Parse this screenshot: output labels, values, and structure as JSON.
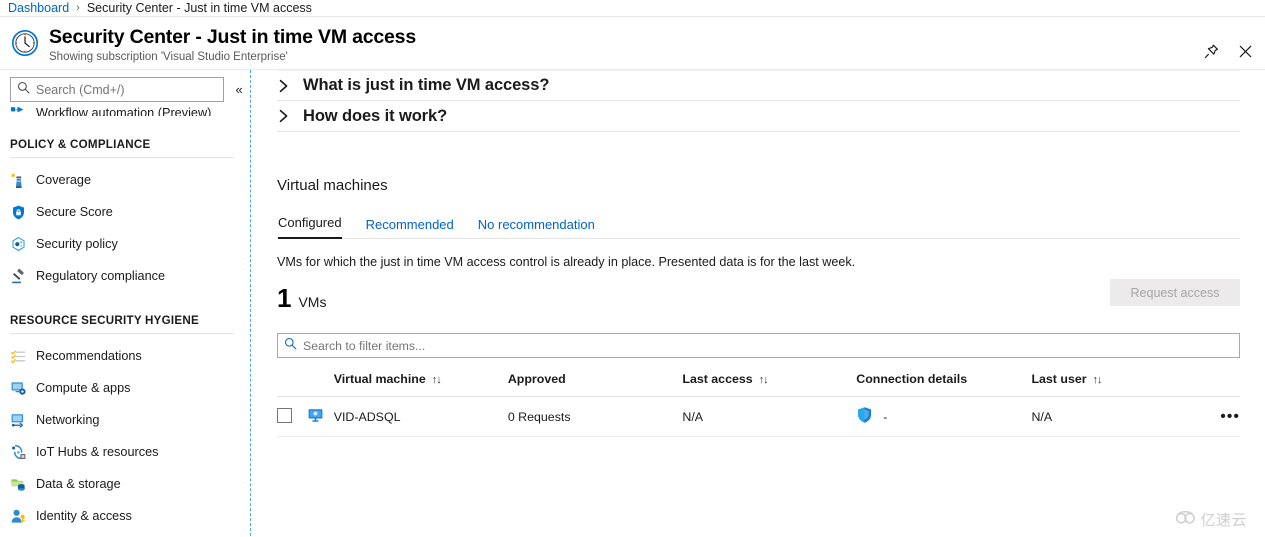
{
  "breadcrumb": {
    "root": "Dashboard",
    "separator": "›",
    "current": "Security Center - Just in time VM access"
  },
  "header": {
    "title": "Security Center - Just in time VM access",
    "subtitle": "Showing subscription 'Visual Studio Enterprise'",
    "icon": "clock-icon",
    "actions": [
      {
        "name": "pin-blade-button",
        "icon": "pin-icon",
        "label": "Pin"
      },
      {
        "name": "close-blade-button",
        "icon": "close-icon",
        "label": "Close"
      }
    ]
  },
  "sidebar": {
    "search": {
      "placeholder": "Search (Cmd+/)",
      "value": "",
      "icon": "search-icon"
    },
    "collapse_label": "«",
    "clipped_item": {
      "label": "Workflow automation (Preview)",
      "icon": "workflow-icon"
    },
    "groups": [
      {
        "title": "POLICY & COMPLIANCE",
        "items": [
          {
            "label": "Coverage",
            "icon": "lighthouse-icon"
          },
          {
            "label": "Secure Score",
            "icon": "shield-icon"
          },
          {
            "label": "Security policy",
            "icon": "policy-hexagon-icon"
          },
          {
            "label": "Regulatory compliance",
            "icon": "gavel-icon"
          }
        ]
      },
      {
        "title": "RESOURCE SECURITY HYGIENE",
        "items": [
          {
            "label": "Recommendations",
            "icon": "checklist-icon"
          },
          {
            "label": "Compute & apps",
            "icon": "compute-icon"
          },
          {
            "label": "Networking",
            "icon": "networking-icon"
          },
          {
            "label": "IoT Hubs & resources",
            "icon": "iot-hub-icon"
          },
          {
            "label": "Data & storage",
            "icon": "database-icon"
          },
          {
            "label": "Identity & access",
            "icon": "identity-icon"
          }
        ]
      }
    ]
  },
  "main": {
    "accordions": [
      {
        "label": "What is just in time VM access?",
        "icon": "chevron-right-icon",
        "expanded": false
      },
      {
        "label": "How does it work?",
        "icon": "chevron-right-icon",
        "expanded": false
      }
    ],
    "section_title": "Virtual machines",
    "tabs": [
      {
        "label": "Configured",
        "active": true
      },
      {
        "label": "Recommended",
        "active": false
      },
      {
        "label": "No recommendation",
        "active": false
      }
    ],
    "tab_description": "VMs for which the just in time VM access control is already in place. Presented data is for the last week.",
    "count": {
      "number": "1",
      "unit": "VMs"
    },
    "request_access": {
      "label": "Request access",
      "disabled": true
    },
    "filter": {
      "placeholder": "Search to filter items...",
      "value": "",
      "icon": "search-icon"
    },
    "table": {
      "columns": [
        {
          "label": "",
          "name": "select-all-column",
          "sortable": false
        },
        {
          "label": "",
          "name": "icon-column",
          "sortable": false
        },
        {
          "label": "Virtual machine",
          "name": "virtual-machine-column",
          "sortable": true
        },
        {
          "label": "Approved",
          "name": "approved-column",
          "sortable": false
        },
        {
          "label": "Last access",
          "name": "last-access-column",
          "sortable": true
        },
        {
          "label": "Connection details",
          "name": "connection-details-column",
          "sortable": false
        },
        {
          "label": "Last user",
          "name": "last-user-column",
          "sortable": true
        },
        {
          "label": "",
          "name": "actions-column",
          "sortable": false
        }
      ],
      "sort_glyph": "↑↓",
      "rows": [
        {
          "selected": false,
          "icon": "virtual-machine-icon",
          "virtual_machine": "VID-ADSQL",
          "approved": "0 Requests",
          "last_access": "N/A",
          "connection_icon": "shield-icon",
          "connection_details": "-",
          "last_user": "N/A",
          "more": "•••"
        }
      ]
    }
  },
  "watermark": {
    "text": "亿速云",
    "icon": "cloud-icon"
  },
  "colors": {
    "link": "#0064c8",
    "accent": "#0078d4",
    "text": "#1b1b1b",
    "disabled_bg": "#eceaea",
    "disabled_text": "#a6a6a6",
    "sidebar_divider": "#4aa8d8"
  }
}
